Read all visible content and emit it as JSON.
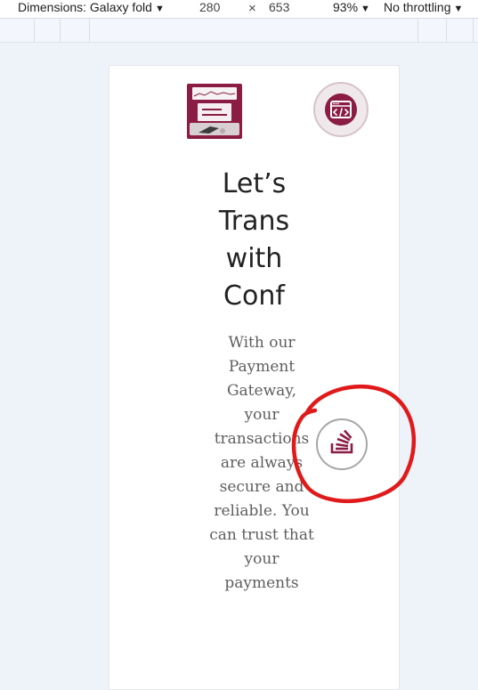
{
  "devtools": {
    "dimensions_label": "Dimensions: Galaxy fold",
    "width": "280",
    "times": "×",
    "height": "653",
    "zoom": "93%",
    "throttling": "No throttling",
    "caret": "▼"
  },
  "page": {
    "logo_alt_icon": "payment-gateway-illustration",
    "code_icon": "code-window-icon",
    "hero_title_lines": [
      "Let’s",
      "Trans",
      "with",
      "Conf"
    ],
    "hero_text": "With our Payment Gateway, your transactions are always secure and reliable. You can trust that your payments",
    "stack_icon": "stack-overflow-icon",
    "annotation_color": "#e01a1a",
    "brand_color": "#8b1c44"
  }
}
